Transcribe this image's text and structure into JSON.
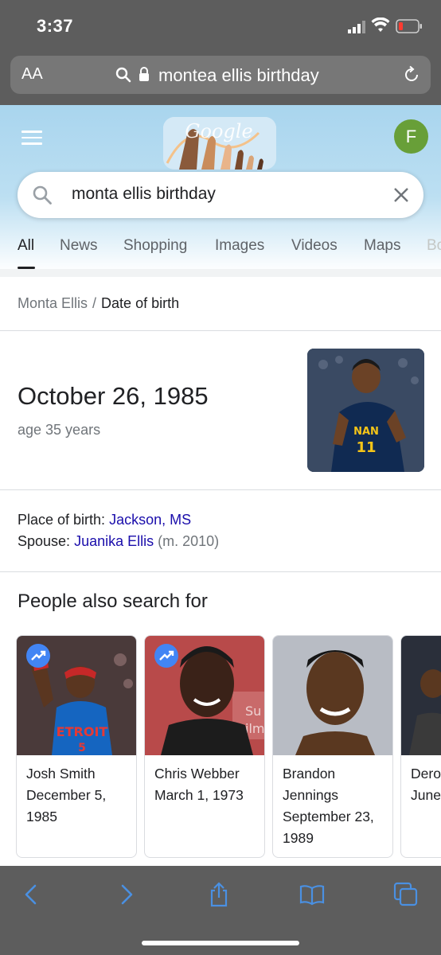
{
  "status_bar": {
    "time": "3:37"
  },
  "url_bar": {
    "aa": "AA",
    "url": "montea ellis birthday"
  },
  "search": {
    "query": "monta ellis birthday"
  },
  "header": {
    "avatar_letter": "F"
  },
  "tabs": [
    {
      "label": "All",
      "active": true
    },
    {
      "label": "News"
    },
    {
      "label": "Shopping"
    },
    {
      "label": "Images"
    },
    {
      "label": "Videos"
    },
    {
      "label": "Maps"
    },
    {
      "label": "Bo"
    }
  ],
  "knowledge": {
    "breadcrumb": {
      "subject": "Monta Ellis",
      "separator": "/",
      "attribute": "Date of birth"
    },
    "answer": "October 26, 1985",
    "age": "age 35 years",
    "place_of_birth_label": "Place of birth:",
    "place_of_birth_value": "Jackson, MS",
    "spouse_label": "Spouse:",
    "spouse_value": "Juanika Ellis",
    "spouse_note": "(m. 2010)"
  },
  "people_also_search": {
    "title": "People also search for",
    "cards": [
      {
        "line1": "Josh Smith",
        "line2": "December 5,",
        "line3": "1985",
        "line4": "",
        "trending": true
      },
      {
        "line1": "Chris Webber",
        "line2": "March 1, 1973",
        "line3": "",
        "line4": "",
        "trending": true
      },
      {
        "line1": "Brandon",
        "line2": "Jennings",
        "line3": "September 23,",
        "line4": "1989",
        "trending": false
      },
      {
        "line1": "Dero",
        "line2": "June",
        "line3": "",
        "line4": "",
        "trending": false
      }
    ]
  },
  "colors": {
    "link": "#1a0dab",
    "trend": "#4285f4",
    "toolbar_icon": "#4a90e2",
    "avatar": "#689f38"
  },
  "toolbar": {
    "icons": [
      "back-icon",
      "forward-icon",
      "share-icon",
      "bookmarks-icon",
      "tabs-icon"
    ]
  }
}
